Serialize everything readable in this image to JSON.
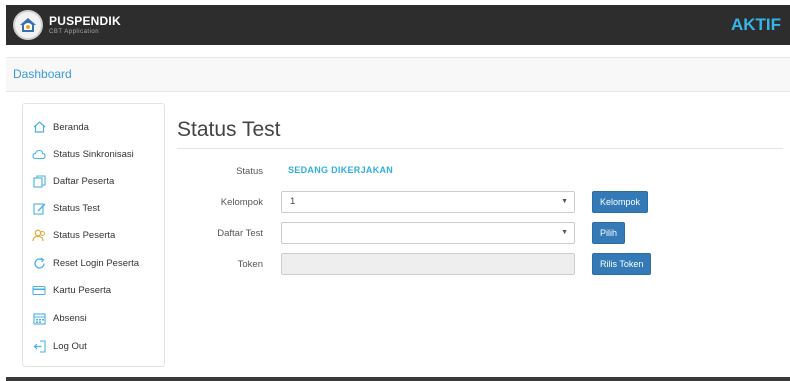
{
  "header": {
    "brand_title": "PUSPENDIK",
    "brand_subtitle": "CBT Application",
    "status_text": "AKTIF"
  },
  "breadcrumb": "Dashboard",
  "sidebar": {
    "items": [
      {
        "label": "Beranda",
        "icon": "home-icon"
      },
      {
        "label": "Status Sinkronisasi",
        "icon": "cloud-icon"
      },
      {
        "label": "Daftar Peserta",
        "icon": "documents-icon"
      },
      {
        "label": "Status Test",
        "icon": "edit-icon"
      },
      {
        "label": "Status Peserta",
        "icon": "users-icon"
      },
      {
        "label": "Reset Login Peserta",
        "icon": "refresh-icon"
      },
      {
        "label": "Kartu Peserta",
        "icon": "card-icon"
      },
      {
        "label": "Absensi",
        "icon": "calendar-icon"
      },
      {
        "label": "Log Out",
        "icon": "logout-icon"
      }
    ]
  },
  "main": {
    "title": "Status Test",
    "status_label": "Status",
    "status_value": "SEDANG DIKERJAKAN",
    "kelompok_label": "Kelompok",
    "kelompok_value": "1",
    "kelompok_button": "Kelompok",
    "daftar_test_label": "Daftar Test",
    "daftar_test_value": "",
    "pilih_button": "Pilih",
    "token_label": "Token",
    "token_value": "",
    "rilis_token_button": "Rilis Token"
  },
  "colors": {
    "header_bg": "#2d2d2d",
    "accent": "#35b5ea",
    "button": "#337ab7",
    "icon": "#4ab1e3"
  }
}
